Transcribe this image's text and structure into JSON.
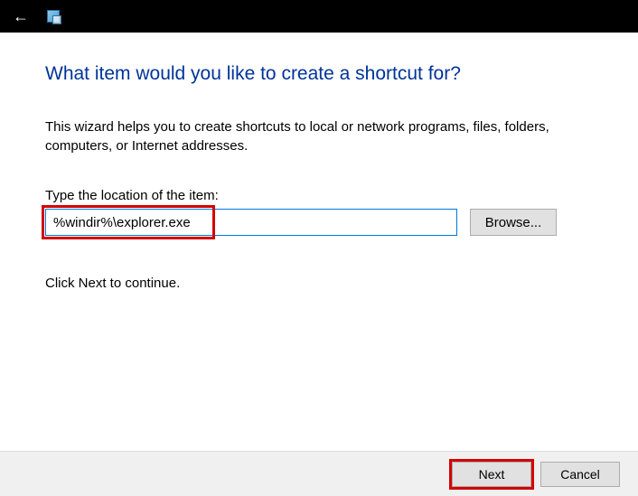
{
  "header": {
    "heading": "What item would you like to create a shortcut for?",
    "description": "This wizard helps you to create shortcuts to local or network programs, files, folders, computers, or Internet addresses."
  },
  "field": {
    "label": "Type the location of the item:",
    "value": "%windir%\\explorer.exe",
    "browse_label": "Browse..."
  },
  "continue_text": "Click Next to continue.",
  "footer": {
    "next_label": "Next",
    "cancel_label": "Cancel"
  }
}
